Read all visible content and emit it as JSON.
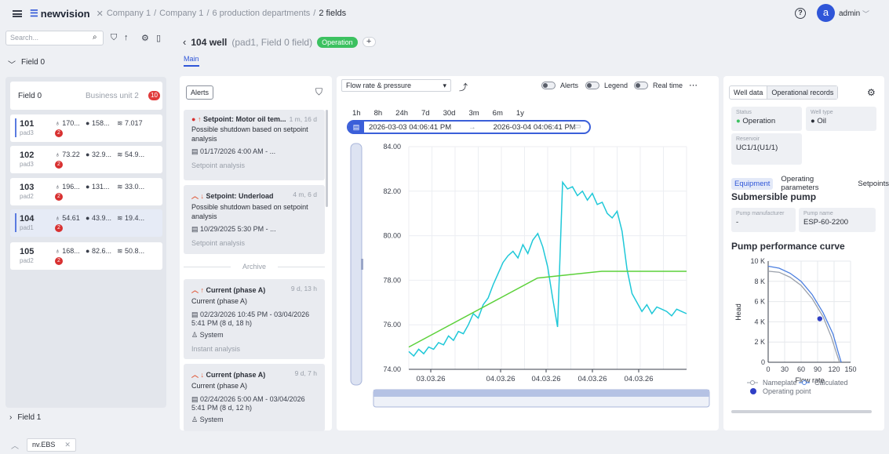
{
  "header": {
    "logo_text": "newvision",
    "breadcrumb": [
      "Company 1",
      "Company 1",
      "6 production departments",
      "2 fields"
    ],
    "user": "admin",
    "avatar_letter": "a"
  },
  "sidebar": {
    "search_placeholder": "Search...",
    "field0_label": "Field 0",
    "field1_label": "Field 1",
    "field_card": {
      "title": "Field 0",
      "business_unit": "Business unit 2",
      "count": "10"
    },
    "wells": [
      {
        "id": "101",
        "pad": "pad3",
        "m1": "170...",
        "m2": "158...",
        "m3": "7.017",
        "alarms": "2"
      },
      {
        "id": "102",
        "pad": "pad3",
        "m1": "73.22",
        "m2": "32.9...",
        "m3": "54.9...",
        "alarms": "2"
      },
      {
        "id": "103",
        "pad": "pad2",
        "m1": "196...",
        "m2": "131...",
        "m3": "33.0...",
        "alarms": "2"
      },
      {
        "id": "104",
        "pad": "pad1",
        "m1": "54.61",
        "m2": "43.9...",
        "m3": "19.4...",
        "alarms": "2"
      },
      {
        "id": "105",
        "pad": "pad2",
        "m1": "168...",
        "m2": "82.6...",
        "m3": "50.8...",
        "alarms": "2"
      }
    ]
  },
  "well_header": {
    "name": "104 well",
    "sub": "(pad1, Field 0 field)",
    "status": "Operation",
    "tab_main": "Main"
  },
  "alerts": {
    "button": "Alerts",
    "archive_label": "Archive",
    "items": [
      {
        "title": "Setpoint: Motor oil tem...",
        "age": "1 m, 16 d",
        "desc": "Possible shutdown based on setpoint analysis",
        "date": "01/17/2026 4:00 AM - ...",
        "type": "Setpoint analysis"
      },
      {
        "title": "Setpoint: Underload",
        "age": "4 m, 6 d",
        "desc": "Possible shutdown based on setpoint analysis",
        "date": "10/29/2025 5:30 PM - ...",
        "type": "Setpoint analysis"
      },
      {
        "title": "Current (phase A)",
        "age": "9 d, 13 h",
        "desc": "Current (phase A)",
        "date": "02/23/2026 10:45 PM - 03/04/2026 5:41 PM  (8 d, 18 h)",
        "user": "System",
        "type": "Instant analysis"
      },
      {
        "title": "Current (phase A)",
        "age": "9 d, 7 h",
        "desc": "Current (phase A)",
        "date": "02/24/2026 5:00 AM - 03/04/2026 5:41 PM  (8 d, 12 h)",
        "user": "System"
      }
    ]
  },
  "chart_panel": {
    "selector": "Flow rate & pressure",
    "toggle_alerts": "Alerts",
    "toggle_legend": "Legend",
    "toggle_realtime": "Real time",
    "ranges": [
      "1h",
      "8h",
      "24h",
      "7d",
      "30d",
      "3m",
      "6m",
      "1y"
    ],
    "date_from": "2026-03-03 04:06:41 PM",
    "date_to": "2026-03-04 04:06:41 PM"
  },
  "chart_data": [
    {
      "type": "line",
      "ylim": [
        74,
        84
      ],
      "yticks": [
        "84.00",
        "82.00",
        "80.00",
        "78.00",
        "76.00",
        "74.00"
      ],
      "xticks": [
        "03.03.26",
        "04.03.26",
        "04.03.26",
        "04.03.26",
        "04.03.26"
      ],
      "colors": {
        "cyan": "#1fc8d8",
        "green": "#5cd13a"
      },
      "series": [
        {
          "values": [
            74.8,
            74.6,
            74.9,
            74.7,
            75.0,
            74.9,
            75.2,
            75.1,
            75.5,
            75.3,
            75.7,
            75.6,
            76.0,
            76.5,
            76.3,
            76.9,
            77.2,
            77.8,
            78.3,
            78.8,
            79.1,
            79.3,
            79.0,
            79.6,
            79.2,
            79.8,
            80.1,
            79.5,
            78.6,
            77.2,
            75.9,
            82.4,
            82.1,
            82.2,
            81.8,
            82.0,
            81.6,
            81.9,
            81.4,
            81.5,
            81.0,
            80.8,
            81.1,
            80.2,
            78.5,
            77.4,
            77.0,
            76.6,
            76.9,
            76.5,
            76.8,
            76.7,
            76.6,
            76.4,
            76.7,
            76.6,
            76.5
          ]
        },
        {
          "values": [
            75.0,
            78.1,
            78.4,
            78.4
          ]
        }
      ]
    },
    {
      "type": "line",
      "title": "Pump performance curve",
      "ylabel": "Head",
      "xlabel": "Flow rate",
      "xlim": [
        0,
        150
      ],
      "ylim": [
        0,
        10000
      ],
      "xticks": [
        "0",
        "30",
        "60",
        "90",
        "120",
        "150"
      ],
      "yticks": [
        "10 K",
        "8 K",
        "6 K",
        "4 K",
        "2 K",
        "0"
      ],
      "legend": [
        "Nameplate",
        "Calculated",
        "Operating point"
      ],
      "series": [
        {
          "name": "Nameplate",
          "x": [
            0,
            20,
            40,
            60,
            80,
            100,
            115,
            125,
            130
          ],
          "values": [
            9000,
            8900,
            8400,
            7600,
            6300,
            4500,
            2500,
            800,
            0
          ]
        },
        {
          "name": "Calculated",
          "x": [
            0,
            20,
            40,
            60,
            80,
            100,
            118,
            128,
            133
          ],
          "values": [
            9500,
            9300,
            8800,
            8000,
            6700,
            4900,
            2800,
            900,
            0
          ]
        },
        {
          "name": "Operating point",
          "x": [
            94
          ],
          "values": [
            4300
          ]
        }
      ]
    }
  ],
  "right_panel": {
    "tab_well": "Well data",
    "tab_ops": "Operational records",
    "status_k": "Status",
    "status_v": "Operation",
    "type_k": "Well type",
    "type_v": "Oil",
    "res_k": "Reservoir",
    "res_v": "UC1/1(U1/1)",
    "etab_equipment": "Equipment",
    "etab_params": "Operating parameters",
    "etab_setpoints": "Setpoints",
    "pump_title": "Submersible pump",
    "manu_k": "Pump manufacturer",
    "manu_v": "-",
    "pname_k": "Pump name",
    "pname_v": "ESP-60-2200"
  },
  "bottom": {
    "tab": "nv.EBS"
  }
}
